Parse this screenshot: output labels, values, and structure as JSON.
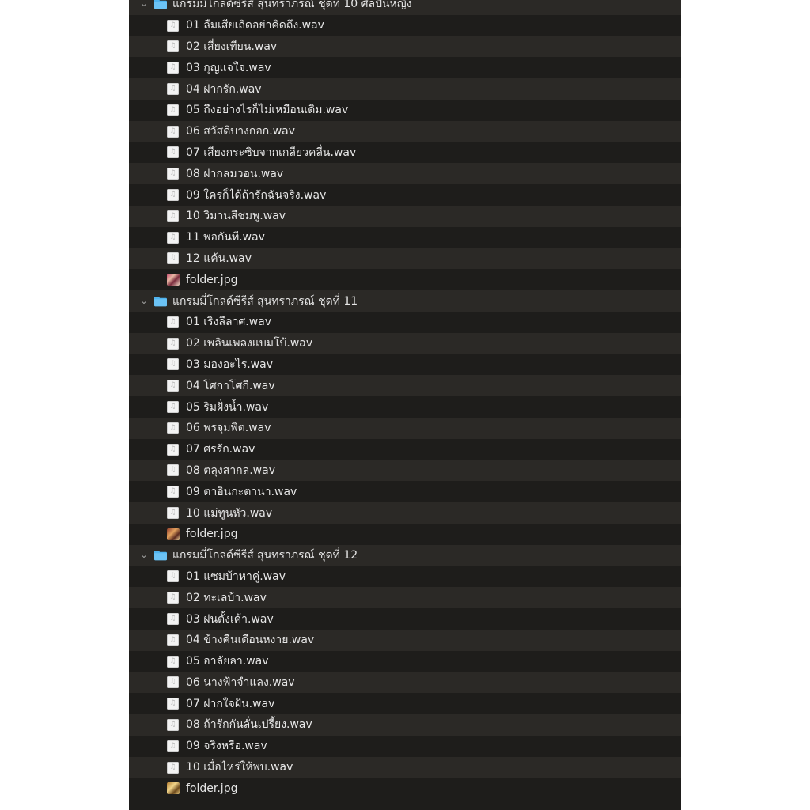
{
  "groups": [
    {
      "name": "แกรมมี่โกลด์ซีรีส์ สุนทราภรณ์ ชุดที่ 10 ศิลปินหญิง",
      "files": [
        "01 ลืมเสียเถิดอย่าคิดถึง.wav",
        "02 เสี่ยงเทียน.wav",
        "03 กุญแจใจ.wav",
        "04  ฝากรัก.wav",
        "05 ถึงอย่างไรก็ไม่เหมือนเดิม.wav",
        "06 สวัสดีบางกอก.wav",
        "07 เสียงกระซิบจากเกลียวคลื่น.wav",
        "08  ฝากลมวอน.wav",
        "09 ใครก็ได้ถ้ารักฉันจริง.wav",
        "10  วิมานสีชมพู.wav",
        "11 พอกันที.wav",
        "12  แค้น.wav"
      ],
      "image": "folder.jpg"
    },
    {
      "name": "แกรมมี่โกลด์ซีรีส์ สุนทราภรณ์ ชุดที่ 11",
      "files": [
        "01 เริงลีลาศ.wav",
        "02 เพลินเพลงแบมโบ้.wav",
        "03 มองอะไร.wav",
        "04 โศกาโศกี.wav",
        "05 ริมฝั่งน้ำ.wav",
        "06 พรจุมพิต.wav",
        "07 ศรรัก.wav",
        "08 ตลุงสากล.wav",
        "09 ตาอินกะตานา.wav",
        "10 แม่ทูนหัว.wav"
      ],
      "image": "folder.jpg"
    },
    {
      "name": "แกรมมี่โกลด์ซีรีส์ สุนทราภรณ์ ชุดที่ 12",
      "files": [
        "01 แซมบ้าหาคู่.wav",
        "02 ทะเลบ้า.wav",
        "03 ฝนตั้งเค้า.wav",
        "04 ข้างคืนเดือนหงาย.wav",
        "05 อาลัยลา.wav",
        "06 นางฟ้าจำแลง.wav",
        "07 ฝากใจฝัน.wav",
        "08 ถ้ารักกันลั่นเปรี้ยง.wav",
        "09 จริงหรือ.wav",
        "10 เมื่อไหร่ให้พบ.wav"
      ],
      "image": "folder.jpg"
    }
  ],
  "icons": {
    "expanded": "chevron-down-icon",
    "folder": "folder-icon",
    "audio": "audio-file-icon",
    "image": "image-thumbnail-icon"
  },
  "colors": {
    "row_even": "#1e1d1b",
    "row_odd": "#2b2926",
    "text": "#e6e6e6",
    "folder_blue": "#4fb3ee"
  }
}
